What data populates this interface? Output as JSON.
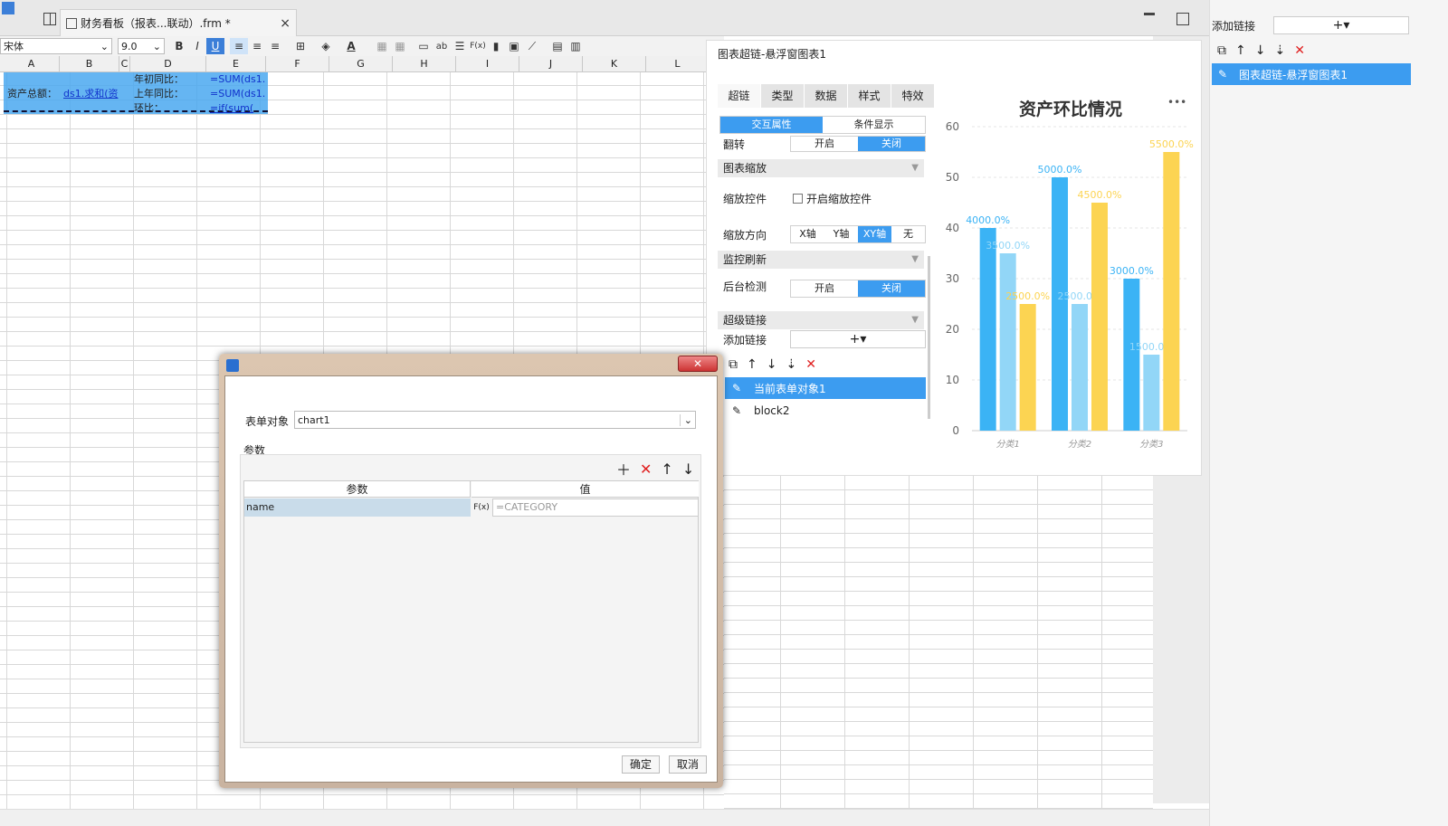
{
  "tabbar": {
    "doc_tab": "财务看板（报表...联动）.frm *",
    "close": "×"
  },
  "toolbar": {
    "font": "宋体",
    "size": "9.0",
    "bold": "B",
    "italic": "I",
    "underline": "U",
    "fx": "F(x)",
    "ab": "ab"
  },
  "sheet": {
    "columns": [
      "A",
      "B",
      "C",
      "D",
      "E",
      "F",
      "G",
      "H",
      "I",
      "J",
      "K",
      "L"
    ],
    "cells": {
      "d1": "年初同比：",
      "e1": "=SUM(ds1.",
      "a2": "资产总额：",
      "b2": "ds1.求和(资",
      "d2": "上年同比：",
      "e2": "=SUM(ds1.",
      "d3": "环比：",
      "e3": "=if(sum("
    }
  },
  "prop": {
    "title": "图表超链-悬浮窗图表1",
    "tabs": [
      "超链",
      "类型",
      "数据",
      "样式",
      "特效"
    ],
    "subtabs": [
      "交互属性",
      "条件显示"
    ],
    "flip_label": "翻转",
    "on": "开启",
    "off": "关闭",
    "zoom_section": "图表缩放",
    "zoom_ctrl_label": "缩放控件",
    "zoom_ctrl_checkbox": "开启缩放控件",
    "zoom_dir_label": "缩放方向",
    "zoom_dirs": [
      "X轴",
      "Y轴",
      "XY轴",
      "无"
    ],
    "monitor_section": "监控刷新",
    "bg_check_label": "后台检测",
    "hyperlink_section": "超级链接",
    "add_link_label": "添加链接",
    "add_link_btn": "+▾",
    "links": [
      "当前表单对象1",
      "block2"
    ]
  },
  "chart_data": {
    "type": "bar",
    "title": "资产环比情况",
    "more": "•••",
    "categories": [
      "分类1",
      "分类2",
      "分类3"
    ],
    "ylim": [
      0,
      60
    ],
    "yticks": [
      "0",
      "10",
      "20",
      "30",
      "40",
      "50",
      "60"
    ],
    "series": [
      {
        "values": [
          40,
          50,
          30
        ],
        "labels": [
          "4000.0%",
          "5000.0%",
          "3000.0%"
        ],
        "color": "#3bb3f5"
      },
      {
        "values": [
          35,
          25,
          15
        ],
        "labels": [
          "3500.0%",
          "2500.0%",
          "1500.0%"
        ],
        "color": "#92d6f7"
      },
      {
        "values": [
          25,
          45,
          55
        ],
        "labels": [
          "2500.0%",
          "4500.0%",
          "5500.0%"
        ],
        "color": "#fcd452"
      }
    ]
  },
  "rpanel": {
    "add_link_label": "添加链接",
    "add_link_btn": "+▾",
    "item": "图表超链-悬浮窗图表1"
  },
  "dialog": {
    "form_obj_label": "表单对象",
    "form_obj_value": "chart1",
    "params_label": "参数",
    "col_param": "参数",
    "col_value": "值",
    "row_param": "name",
    "row_fx": "F(x)",
    "row_value": "=CATEGORY",
    "ok": "确定",
    "cancel": "取消",
    "close": "✕"
  }
}
